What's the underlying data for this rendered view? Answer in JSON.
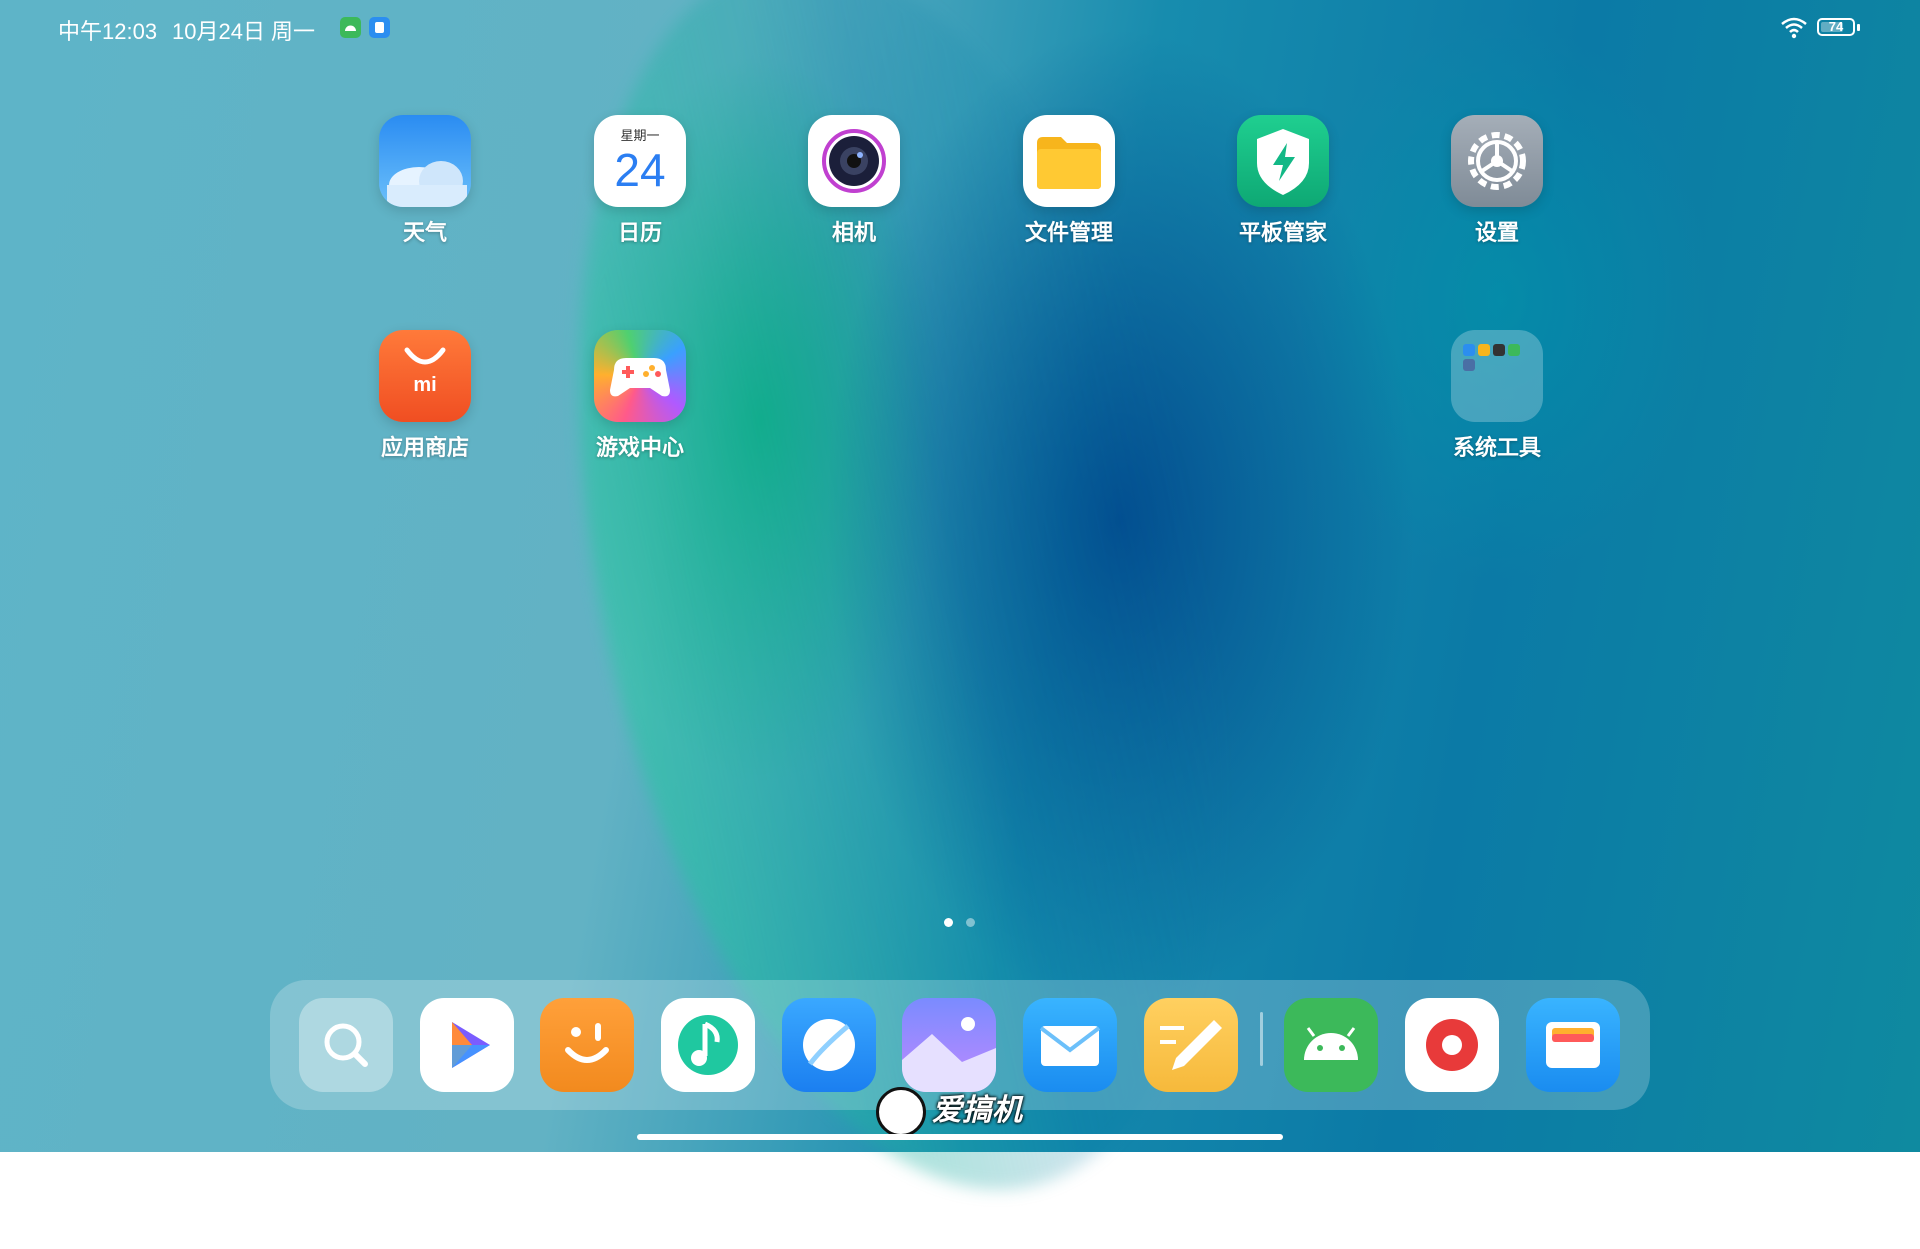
{
  "status_bar": {
    "time": "中午12:03",
    "date": "10月24日 周一",
    "battery": "74",
    "battery_level": 0.74
  },
  "apps": [
    {
      "label": "天气",
      "icon": "weather-icon"
    },
    {
      "label": "日历",
      "icon": "calendar-icon",
      "weekday": "星期一",
      "day": "24"
    },
    {
      "label": "相机",
      "icon": "camera-icon"
    },
    {
      "label": "文件管理",
      "icon": "folder-icon"
    },
    {
      "label": "平板管家",
      "icon": "shield-icon"
    },
    {
      "label": "设置",
      "icon": "gear-icon"
    },
    {
      "label": "应用商店",
      "icon": "app-store-icon",
      "badge": "mi"
    },
    {
      "label": "游戏中心",
      "icon": "gamepad-icon"
    },
    {
      "label": "系统工具",
      "icon": "folder-group-icon"
    }
  ],
  "dock": [
    {
      "icon": "search-icon"
    },
    {
      "icon": "video-play-icon"
    },
    {
      "icon": "smile-icon"
    },
    {
      "icon": "music-note-icon"
    },
    {
      "icon": "browser-icon"
    },
    {
      "icon": "gallery-icon"
    },
    {
      "icon": "mail-icon"
    },
    {
      "icon": "notes-icon"
    },
    {
      "icon": "android-icon"
    },
    {
      "icon": "recorder-icon"
    },
    {
      "icon": "wallet-icon"
    }
  ],
  "page_indicator": {
    "current": 1,
    "total": 2
  },
  "watermark": "爱搞机",
  "colors": {
    "weather": "#2e8ff0",
    "calendar_day": "#2b7ef2",
    "folder": "#f7b51c",
    "shield": "#12b886",
    "settings": "#8e9aa6",
    "store": "#f36030",
    "recorder": "#e83a3a",
    "mail": "#1a9cf5",
    "notes": "#f6b93b",
    "android": "#3cb95a"
  }
}
